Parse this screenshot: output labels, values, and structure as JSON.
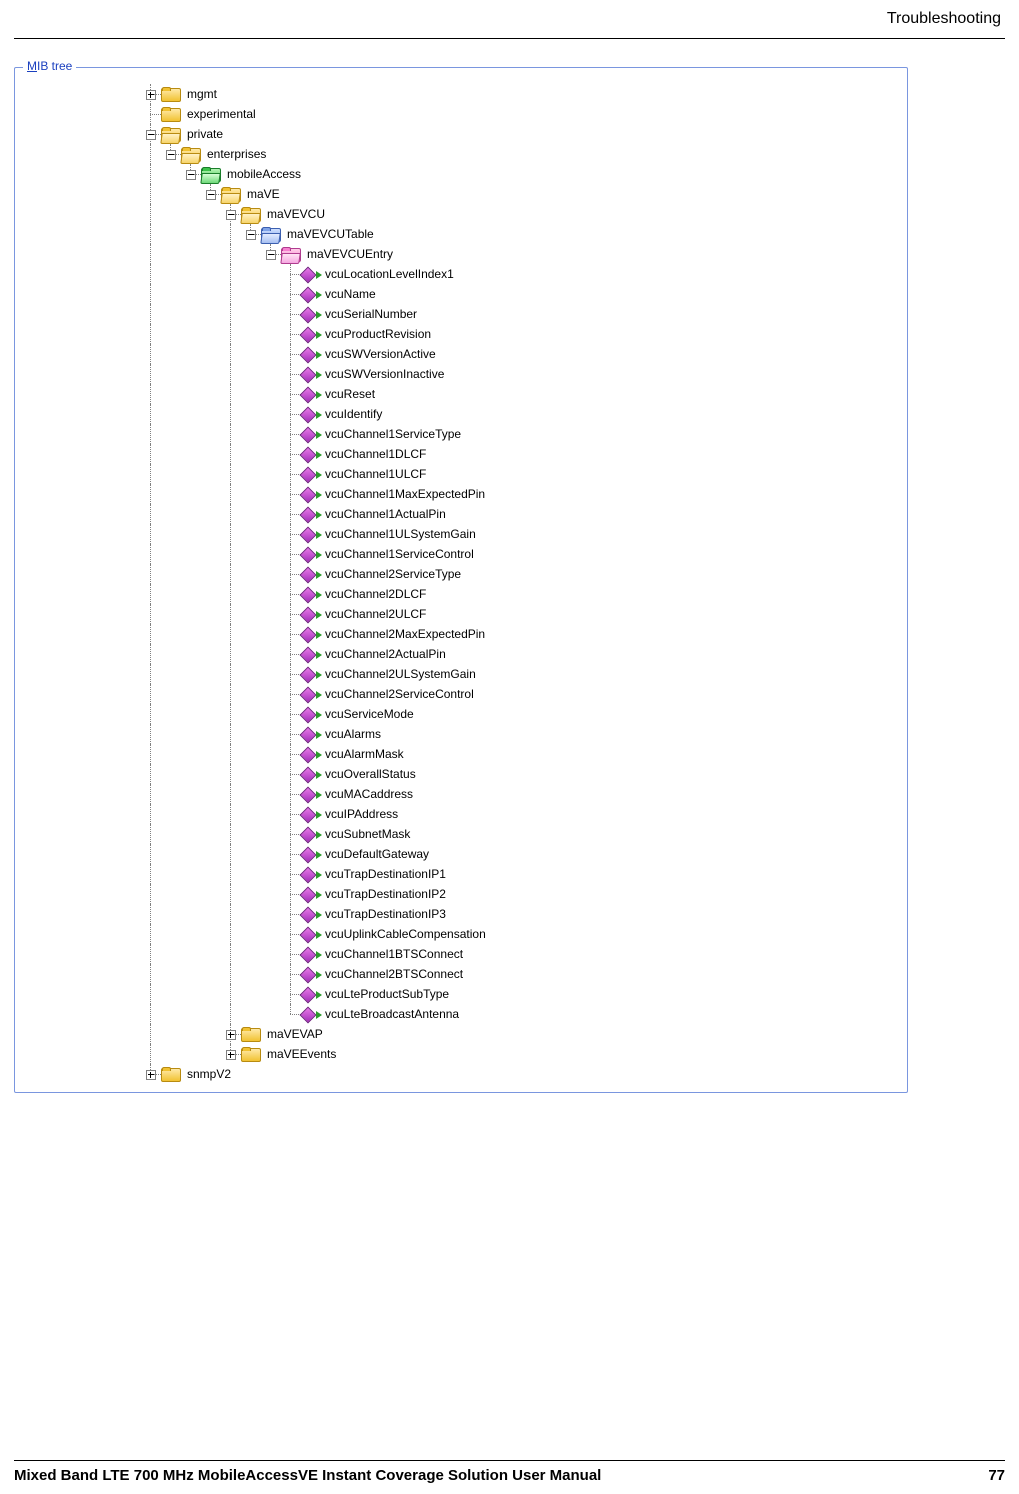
{
  "header": {
    "section": "Troubleshooting"
  },
  "footer": {
    "title": "Mixed Band LTE 700 MHz MobileAccessVE Instant Coverage Solution User Manual",
    "page": "77"
  },
  "panel": {
    "title_u": "M",
    "title_rest": "IB tree"
  },
  "tree": {
    "mgmt": "mgmt",
    "experimental": "experimental",
    "private": "private",
    "enterprises": "enterprises",
    "mobileAccess": "mobileAccess",
    "maVE": "maVE",
    "maVEVCU": "maVEVCU",
    "maVEVCUTable": "maVEVCUTable",
    "maVEVCUEntry": "maVEVCUEntry",
    "leaves": [
      "vcuLocationLevelIndex1",
      "vcuName",
      "vcuSerialNumber",
      "vcuProductRevision",
      "vcuSWVersionActive",
      "vcuSWVersionInactive",
      "vcuReset",
      "vcuIdentify",
      "vcuChannel1ServiceType",
      "vcuChannel1DLCF",
      "vcuChannel1ULCF",
      "vcuChannel1MaxExpectedPin",
      "vcuChannel1ActualPin",
      "vcuChannel1ULSystemGain",
      "vcuChannel1ServiceControl",
      "vcuChannel2ServiceType",
      "vcuChannel2DLCF",
      "vcuChannel2ULCF",
      "vcuChannel2MaxExpectedPin",
      "vcuChannel2ActualPin",
      "vcuChannel2ULSystemGain",
      "vcuChannel2ServiceControl",
      "vcuServiceMode",
      "vcuAlarms",
      "vcuAlarmMask",
      "vcuOverallStatus",
      "vcuMACaddress",
      "vcuIPAddress",
      "vcuSubnetMask",
      "vcuDefaultGateway",
      "vcuTrapDestinationIP1",
      "vcuTrapDestinationIP2",
      "vcuTrapDestinationIP3",
      "vcuUplinkCableCompensation",
      "vcuChannel1BTSConnect",
      "vcuChannel2BTSConnect",
      "vcuLteProductSubType",
      "vcuLteBroadcastAntenna"
    ],
    "maVEVAP": "maVEVAP",
    "maVEEvents": "maVEEvents",
    "snmpV2": "snmpV2"
  }
}
